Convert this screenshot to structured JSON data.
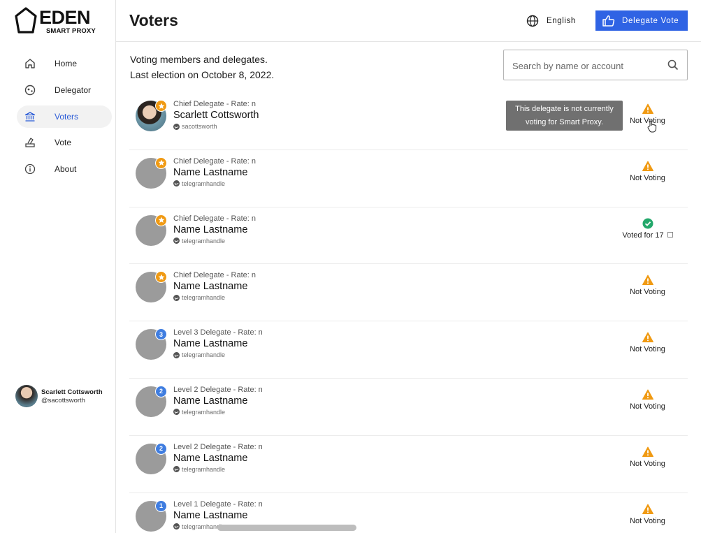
{
  "logo": {
    "word": "EDEN",
    "sub": "SMART PROXY"
  },
  "sidebar": {
    "items": [
      {
        "label": "Home",
        "icon": "home-icon"
      },
      {
        "label": "Delegator",
        "icon": "delegator-icon"
      },
      {
        "label": "Voters",
        "icon": "bank-icon",
        "active": true
      },
      {
        "label": "Vote",
        "icon": "vote-icon"
      },
      {
        "label": "About",
        "icon": "info-icon"
      }
    ],
    "user": {
      "name": "Scarlett Cottsworth",
      "handle": "@sacottsworth"
    }
  },
  "header": {
    "title": "Voters",
    "language": "English",
    "delegate_button": "Delegate Vote"
  },
  "intro": {
    "line1": "Voting members and delegates.",
    "line2": "Last election on October 8, 2022."
  },
  "search": {
    "placeholder": "Search by name or account"
  },
  "tooltip": {
    "line1": "This delegate is not currently",
    "line2": "voting for Smart Proxy."
  },
  "colors": {
    "accent": "#2f63e4",
    "warning": "#f09a13",
    "success": "#23a86b",
    "chief_badge": "#f09a13",
    "level_badge": "#3f7de0"
  },
  "rows": [
    {
      "rank": "Chief Delegate - Rate: n",
      "name": "Scarlett Cottsworth",
      "handle": "sacottsworth",
      "badge": "star",
      "status": "Not Voting",
      "status_type": "warning",
      "photo": true
    },
    {
      "rank": "Chief Delegate - Rate: n",
      "name": "Name Lastname",
      "handle": "telegramhandle",
      "badge": "star",
      "status": "Not Voting",
      "status_type": "warning"
    },
    {
      "rank": "Chief Delegate - Rate: n",
      "name": "Name Lastname",
      "handle": "telegramhandle",
      "badge": "star",
      "status": "Voted for 17",
      "status_type": "success"
    },
    {
      "rank": "Chief Delegate - Rate: n",
      "name": "Name Lastname",
      "handle": "telegramhandle",
      "badge": "star",
      "status": "Not Voting",
      "status_type": "warning"
    },
    {
      "rank": "Level 3 Delegate - Rate: n",
      "name": "Name Lastname",
      "handle": "telegramhandle",
      "badge": "3",
      "status": "Not Voting",
      "status_type": "warning"
    },
    {
      "rank": "Level 2 Delegate - Rate: n",
      "name": "Name Lastname",
      "handle": "telegramhandle",
      "badge": "2",
      "status": "Not Voting",
      "status_type": "warning"
    },
    {
      "rank": "Level 2 Delegate - Rate: n",
      "name": "Name Lastname",
      "handle": "telegramhandle",
      "badge": "2",
      "status": "Not Voting",
      "status_type": "warning"
    },
    {
      "rank": "Level 1 Delegate - Rate: n",
      "name": "Name Lastname",
      "handle": "telegramhandle",
      "badge": "1",
      "status": "Not Voting",
      "status_type": "warning"
    }
  ]
}
